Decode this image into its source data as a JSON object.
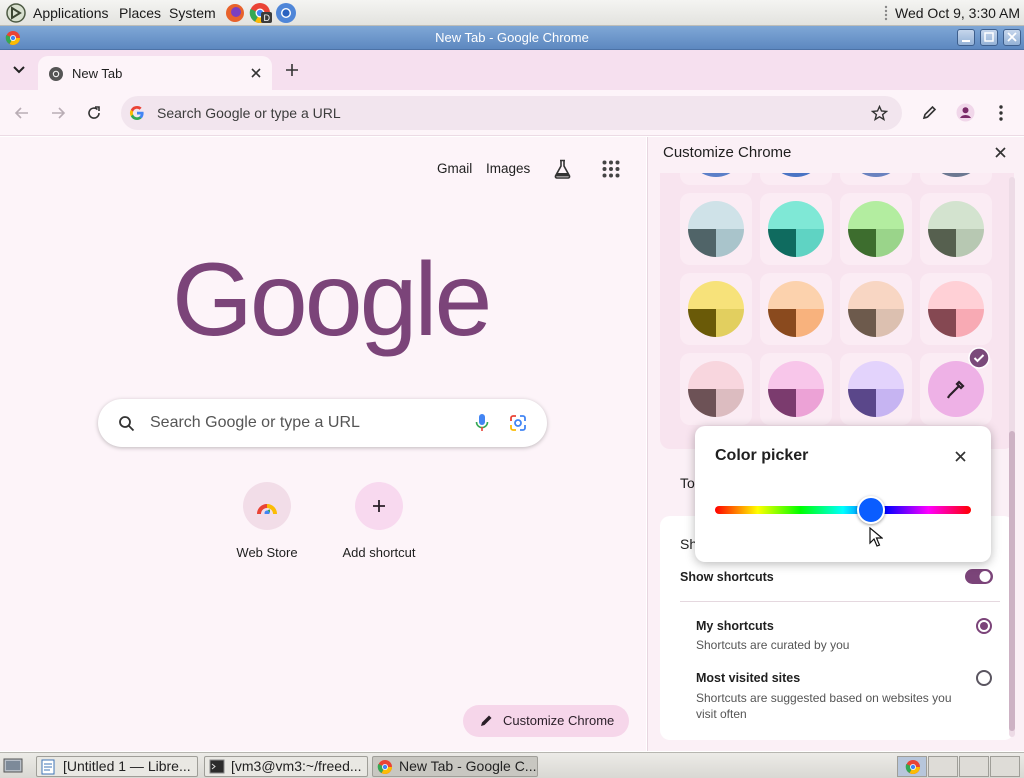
{
  "top_panel": {
    "menus": [
      "Applications",
      "Places",
      "System"
    ],
    "clock": "Wed Oct  9,  3:30 AM"
  },
  "window": {
    "title": "New Tab - Google Chrome"
  },
  "tabs": [
    {
      "label": "New Tab"
    }
  ],
  "omnibox": {
    "placeholder": "Search Google or type a URL"
  },
  "ntp": {
    "links": [
      "Gmail",
      "Images"
    ],
    "logo": "Google",
    "search_placeholder": "Search Google or type a URL",
    "shortcuts": [
      {
        "label": "Web Store",
        "icon": "chrome-web-store-icon"
      },
      {
        "label": "Add shortcut",
        "icon": "plus-icon"
      }
    ],
    "customize_label": "Customize Chrome"
  },
  "panel": {
    "title": "Customize Chrome",
    "swatch_rows": [
      [
        {
          "top": "#cfe2e8",
          "left": "#506468",
          "right": "#a9c4cb"
        },
        {
          "top": "#7fe8d6",
          "left": "#0f6b5f",
          "right": "#5fd3c3"
        },
        {
          "top": "#b3eda0",
          "left": "#3d6d2e",
          "right": "#9ad48a"
        },
        {
          "top": "#d3e3cf",
          "left": "#56604f",
          "right": "#b7c8b2"
        }
      ],
      [
        {
          "top": "#f7e27a",
          "left": "#6a5a08",
          "right": "#e2cf5f"
        },
        {
          "top": "#fcd2ad",
          "left": "#8a4a1e",
          "right": "#f8b27d"
        },
        {
          "top": "#f8d6c3",
          "left": "#6d5a4c",
          "right": "#dcc0b0"
        },
        {
          "top": "#ffd0d6",
          "left": "#854852",
          "right": "#f8aab4"
        }
      ],
      [
        {
          "top": "#f8d6de",
          "left": "#6d5256",
          "right": "#dcbcc0"
        },
        {
          "top": "#f8c6ea",
          "left": "#7b3b6e",
          "right": "#eca2d6"
        },
        {
          "top": "#e3d3fc",
          "left": "#5a478a",
          "right": "#c6b4f2"
        },
        {
          "top": "#eeb1e6",
          "left": "#eeb1e6",
          "right": "#eeb1e6",
          "custom": true
        }
      ]
    ],
    "toolbar_section_partial": "To",
    "shortcuts_section_partial": "Sh",
    "show_shortcuts_label": "Show shortcuts",
    "options": [
      {
        "title": "My shortcuts",
        "subtitle": "Shortcuts are curated by you",
        "selected": true
      },
      {
        "title": "Most visited sites",
        "subtitle": "Shortcuts are suggested based on websites you visit often",
        "selected": false
      }
    ]
  },
  "color_picker": {
    "title": "Color picker",
    "hue_fraction": 0.61
  },
  "taskbar": {
    "tasks": [
      "[Untitled 1 — Libre...",
      "[vm3@vm3:~/freed...",
      "New Tab - Google C..."
    ]
  },
  "colors": {
    "accent": "#7a4a7a",
    "logo": "#7b4479",
    "ntp_bg": "#fdf4f9"
  }
}
